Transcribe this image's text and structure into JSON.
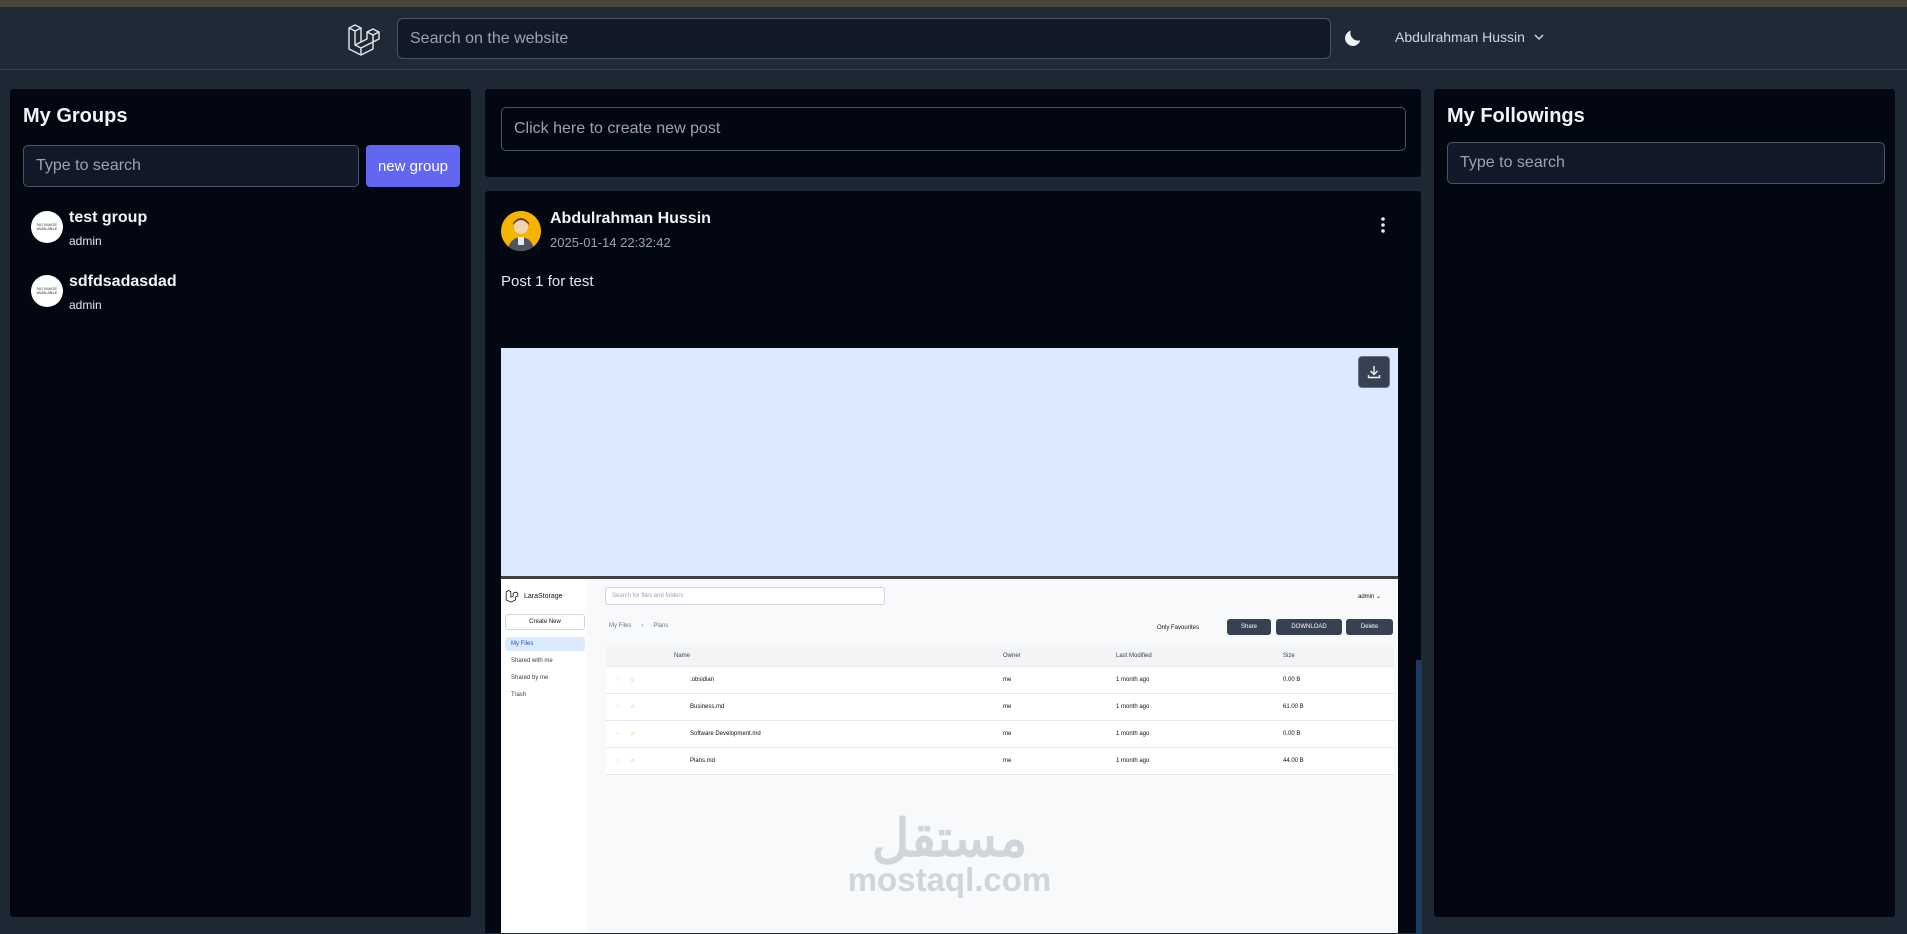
{
  "navbar": {
    "search_placeholder": "Search on the website",
    "user_name": "Abdulrahman Hussin"
  },
  "left_panel": {
    "title": "My Groups",
    "search_placeholder": "Type to search",
    "new_group_label": "new group",
    "groups": [
      {
        "name": "test group",
        "role": "admin",
        "avatar_text": "NO IMAGE AVAILABLE"
      },
      {
        "name": "sdfdsadasdad",
        "role": "admin",
        "avatar_text": "NO IMAGE AVAILABLE"
      }
    ]
  },
  "right_panel": {
    "title": "My Followings",
    "search_placeholder": "Type to search"
  },
  "create_post": {
    "placeholder": "Click here to create new post"
  },
  "post": {
    "author": "Abdulrahman Hussin",
    "date": "2025-01-14 22:32:42",
    "body": "Post 1 for test",
    "attachment": {
      "app_name": "LaraStorage",
      "search_placeholder": "Search for files and folders",
      "user": "admin",
      "create_new": "Create New",
      "nav": [
        "My Files",
        "Shared with me",
        "Shared by me",
        "Trash"
      ],
      "breadcrumb": [
        "My Files",
        "Plans"
      ],
      "only_favourites": "Only Favourites",
      "share": "Share",
      "download": "DOWNLOAD",
      "delete": "Delete",
      "columns": [
        "Name",
        "Owner",
        "Last Modified",
        "Size"
      ],
      "rows": [
        {
          "name": ".obsidian",
          "owner": "me",
          "modified": "1 month ago",
          "size": "0.00 B"
        },
        {
          "name": "Business.md",
          "owner": "me",
          "modified": "1 month ago",
          "size": "61.00 B"
        },
        {
          "name": "Software Development.md",
          "owner": "me",
          "modified": "1 month ago",
          "size": "0.00 B"
        },
        {
          "name": "Plans.md",
          "owner": "me",
          "modified": "1 month ago",
          "size": "44.00 B"
        }
      ],
      "watermark_arabic": "مستقل",
      "watermark_latin": "mostaql.com"
    }
  },
  "colors": {
    "page_bg": "#1e2835",
    "panel_bg": "#030712",
    "accent": "#6366f1",
    "attachment_bg": "#dbeafe"
  }
}
